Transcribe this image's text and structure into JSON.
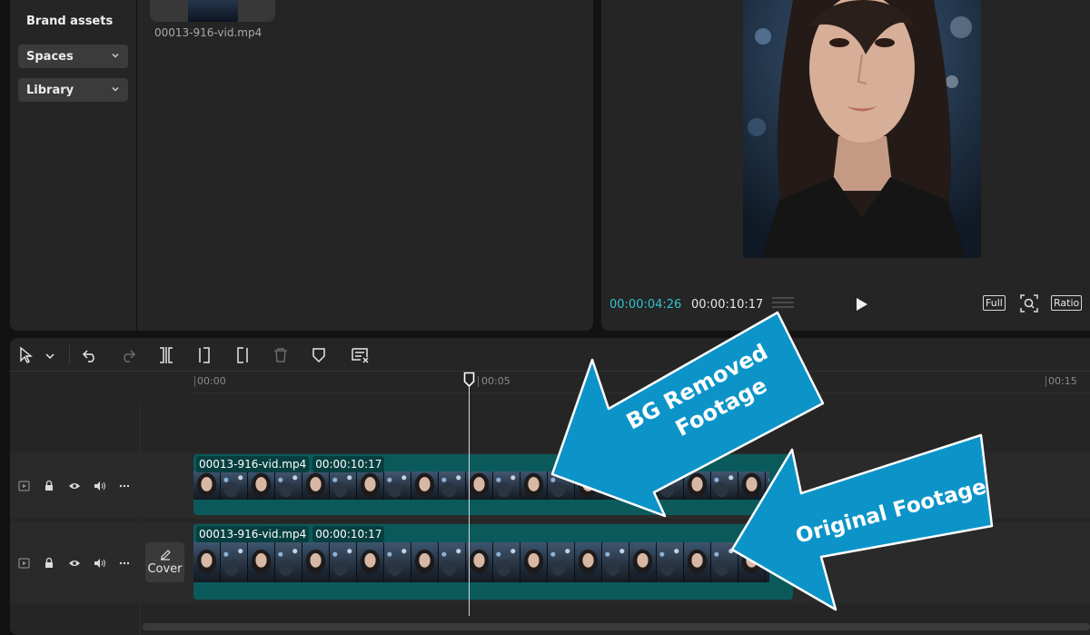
{
  "sidebar": {
    "brand_assets": "Brand assets",
    "spaces": "Spaces",
    "library": "Library"
  },
  "media": {
    "filename": "00013-916-vid.mp4"
  },
  "player": {
    "current_time": "00:00:04:26",
    "total_time": "00:00:10:17",
    "full_label": "Full",
    "ratio_label": "Ratio"
  },
  "timeline": {
    "ruler_ticks": [
      "00:00",
      "00:05",
      "00:15"
    ],
    "tracks": [
      {
        "clip_name": "00013-916-vid.mp4",
        "clip_duration": "00:00:10:17"
      },
      {
        "clip_name": "00013-916-vid.mp4",
        "clip_duration": "00:00:10:17"
      }
    ],
    "cover_label": "Cover"
  },
  "annotations": {
    "bg_removed_line1": "BG Removed",
    "bg_removed_line2": "Footage",
    "original": "Original Footage",
    "arrow_color": "#0c94c8"
  },
  "colors": {
    "accent_time": "#2ec4d0",
    "clip_teal": "#0b5a5b"
  },
  "icons": [
    "chevron-down-icon",
    "play-icon",
    "zoom-fit-icon",
    "select-tool-icon",
    "undo-icon",
    "redo-icon",
    "split-icon",
    "trim-left-icon",
    "trim-right-icon",
    "delete-icon",
    "marker-icon",
    "caption-icon",
    "video-track-icon",
    "lock-icon",
    "eye-icon",
    "audio-icon",
    "more-icon",
    "edit-pencil-icon",
    "playhead-icon"
  ]
}
